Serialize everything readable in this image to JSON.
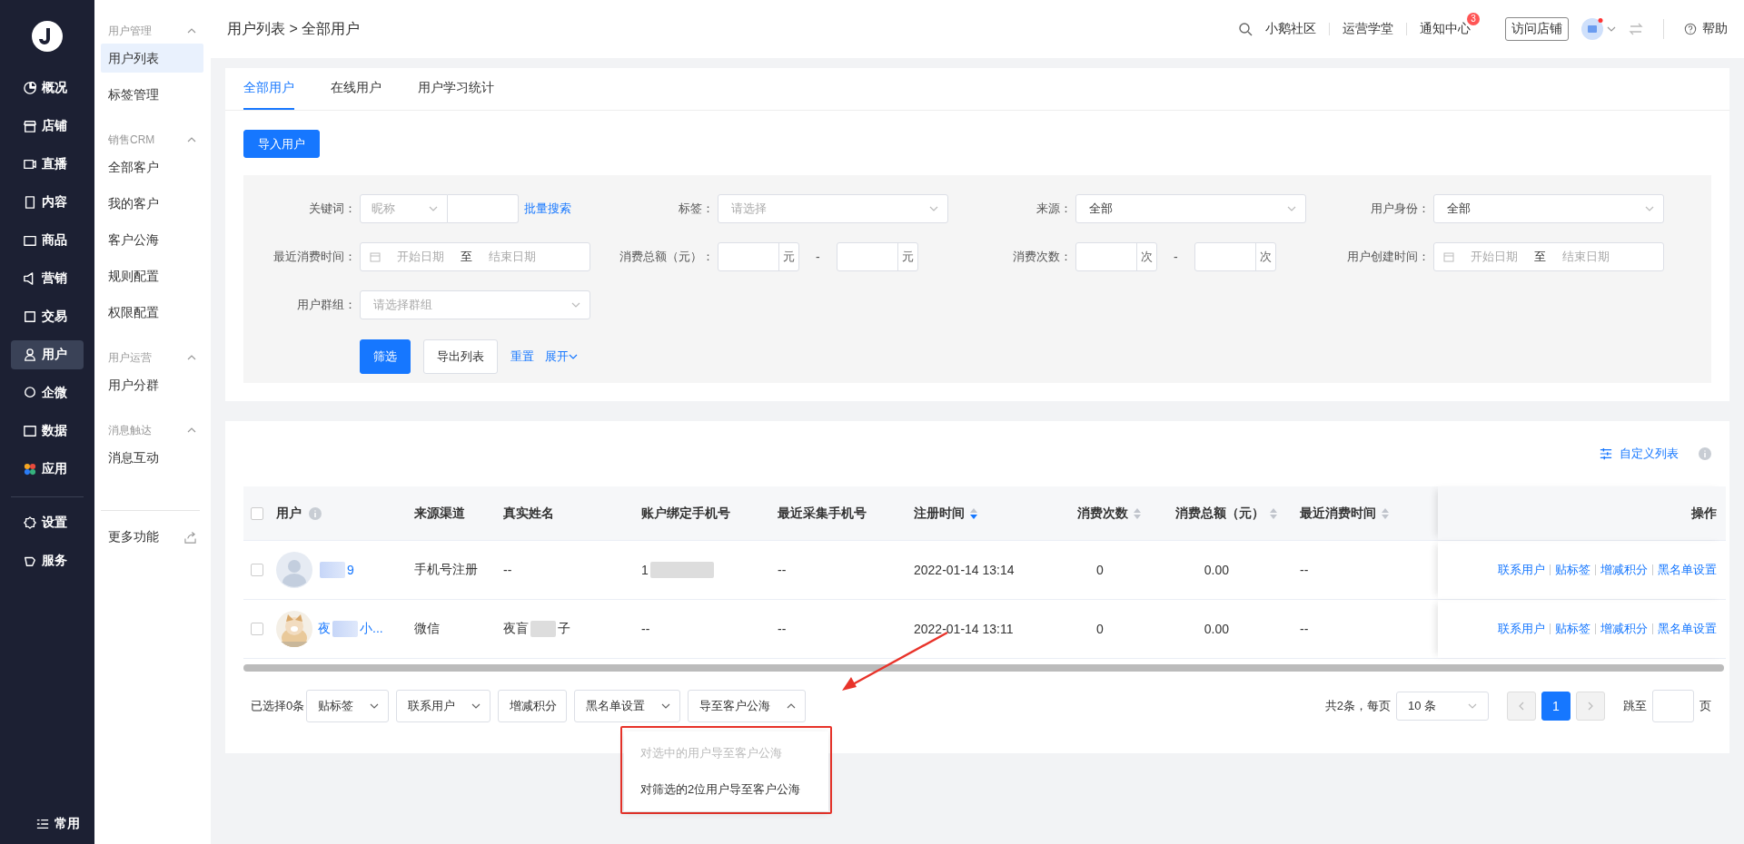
{
  "sidebar": {
    "items": [
      {
        "label": "概况",
        "selected": false
      },
      {
        "label": "店铺",
        "selected": false
      },
      {
        "label": "直播",
        "selected": false
      },
      {
        "label": "内容",
        "selected": false
      },
      {
        "label": "商品",
        "selected": false
      },
      {
        "label": "营销",
        "selected": false
      },
      {
        "label": "交易",
        "selected": false
      },
      {
        "label": "用户",
        "selected": true
      },
      {
        "label": "企微",
        "selected": false
      },
      {
        "label": "数据",
        "selected": false
      },
      {
        "label": "应用",
        "selected": false
      },
      {
        "label": "设置",
        "selected": false
      },
      {
        "label": "服务",
        "selected": false
      }
    ],
    "bottom_item": "常用"
  },
  "subnav": {
    "groups": [
      {
        "title": "用户管理",
        "expanded": true,
        "items": [
          {
            "label": "用户列表",
            "selected": true
          },
          {
            "label": "标签管理",
            "selected": false
          }
        ]
      },
      {
        "title": "销售CRM",
        "expanded": true,
        "items": [
          {
            "label": "全部客户",
            "selected": false
          },
          {
            "label": "我的客户",
            "selected": false
          },
          {
            "label": "客户公海",
            "selected": false
          },
          {
            "label": "规则配置",
            "selected": false
          },
          {
            "label": "权限配置",
            "selected": false
          }
        ]
      },
      {
        "title": "用户运营",
        "expanded": true,
        "items": [
          {
            "label": "用户分群",
            "selected": false
          }
        ]
      },
      {
        "title": "消息触达",
        "expanded": true,
        "items": [
          {
            "label": "消息互动",
            "selected": false
          }
        ]
      }
    ],
    "more": "更多功能"
  },
  "header": {
    "breadcrumb": "用户列表 > 全部用户",
    "links": [
      "小鹅社区",
      "运营学堂",
      "通知中心"
    ],
    "notification_badge": "3",
    "visit_store": "访问店铺",
    "help": "帮助"
  },
  "tabs": [
    {
      "label": "全部用户",
      "selected": true
    },
    {
      "label": "在线用户",
      "selected": false
    },
    {
      "label": "用户学习统计",
      "selected": false
    }
  ],
  "import_button": "导入用户",
  "filters": [
    {
      "kind": "keyword",
      "label": "关键词：",
      "placeholder": "昵称",
      "link": "批量搜索"
    },
    {
      "kind": "select",
      "label": "标签：",
      "placeholder": "请选择"
    },
    {
      "kind": "select",
      "label": "来源：",
      "value": "全部"
    },
    {
      "kind": "select",
      "label": "用户身份：",
      "value": "全部"
    },
    {
      "kind": "daterange",
      "label": "最近消费时间：",
      "start": "开始日期",
      "separator": "至",
      "end": "结束日期"
    },
    {
      "kind": "numrange",
      "label": "消费总额（元）：",
      "units": [
        "元",
        "元"
      ],
      "separator": "-"
    },
    {
      "kind": "numrange",
      "label": "消费次数：",
      "units": [
        "次",
        "次"
      ],
      "separator": "-"
    },
    {
      "kind": "daterange",
      "label": "用户创建时间：",
      "start": "开始日期",
      "separator": "至",
      "end": "结束日期"
    },
    {
      "kind": "select",
      "label": "用户群组：",
      "placeholder": "请选择群组"
    }
  ],
  "filter_actions": {
    "submit": "筛选",
    "export": "导出列表",
    "reset": "重置",
    "expand": "展开"
  },
  "table": {
    "custom_list": "自定义列表",
    "all_selected": false,
    "columns": [
      {
        "label": "用户",
        "info": true
      },
      {
        "label": "来源渠道"
      },
      {
        "label": "真实姓名"
      },
      {
        "label": "账户绑定手机号"
      },
      {
        "label": "最近采集手机号"
      },
      {
        "label": "注册时间",
        "sortable": true,
        "sorted": true
      },
      {
        "label": "消费次数",
        "sortable": true,
        "sorted": false
      },
      {
        "label": "消费总额（元）",
        "sortable": true,
        "sorted": false
      },
      {
        "label": "最近消费时间",
        "sortable": true,
        "sorted": false
      },
      {
        "label": "操作"
      }
    ],
    "rows": [
      {
        "selected": false,
        "avatar": {
          "kind": "default"
        },
        "name": [
          {
            "kind": "redacted"
          },
          {
            "kind": "text",
            "text": "9"
          }
        ],
        "source": "手机号注册",
        "real_name": [
          {
            "kind": "text",
            "text": "--"
          }
        ],
        "bound_phone": [
          {
            "kind": "text",
            "text": "1"
          },
          {
            "kind": "redacted"
          }
        ],
        "collected_phone": "--",
        "registered": "2022-01-14 13:14",
        "count": "0",
        "total": "0.00",
        "last": "--",
        "actions": [
          "联系用户",
          "贴标签",
          "增减积分",
          "黑名单设置"
        ]
      },
      {
        "selected": false,
        "avatar": {
          "kind": "picture"
        },
        "name": [
          {
            "kind": "text",
            "text": "夜"
          },
          {
            "kind": "redacted"
          },
          {
            "kind": "text",
            "text": "小..."
          }
        ],
        "source": "微信",
        "real_name": [
          {
            "kind": "text",
            "text": "夜盲"
          },
          {
            "kind": "redacted"
          },
          {
            "kind": "text",
            "text": "子"
          }
        ],
        "bound_phone": [
          {
            "kind": "text",
            "text": "--"
          }
        ],
        "collected_phone": "--",
        "registered": "2022-01-14 13:11",
        "count": "0",
        "total": "0.00",
        "last": "--",
        "actions": [
          "联系用户",
          "贴标签",
          "增减积分",
          "黑名单设置"
        ]
      }
    ]
  },
  "bulk": {
    "selected_count": "已选择0条",
    "buttons": [
      {
        "label": "贴标签",
        "kind": "dropdown",
        "expanded": false
      },
      {
        "label": "联系用户",
        "kind": "dropdown",
        "expanded": false
      },
      {
        "label": "增减积分",
        "kind": "button"
      },
      {
        "label": "黑名单设置",
        "kind": "dropdown",
        "expanded": false
      },
      {
        "label": "导至客户公海",
        "kind": "dropdown",
        "expanded": true
      }
    ],
    "menu": [
      {
        "label": "对选中的用户导至客户公海",
        "disabled": true
      },
      {
        "label": "对筛选的2位用户导至客户公海",
        "disabled": false
      }
    ]
  },
  "pagination": {
    "total": "共2条，每页",
    "page_size": "10 条",
    "prev_disabled": true,
    "next_disabled": true,
    "pages": [
      {
        "label": "1",
        "selected": true
      }
    ],
    "jump": "跳至",
    "jump_suffix": "页"
  }
}
